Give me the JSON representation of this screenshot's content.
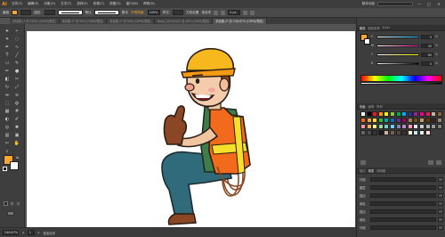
{
  "menubar": {
    "logo": "Ai",
    "items": [
      "文件(F)",
      "编辑(E)",
      "对象(O)",
      "文字(T)",
      "选择(S)",
      "效果(C)",
      "视图(V)",
      "窗口(W)",
      "帮助(H)"
    ],
    "workspace": "基本功能",
    "window_buttons": [
      "—",
      "□",
      "✕"
    ]
  },
  "controlbar": {
    "selection_label": "编组",
    "stroke_label": "描边:",
    "uniform_label": "等比",
    "brush_label": "基本",
    "opacity_label": "不透明度:",
    "opacity_value": "100%",
    "style_label": "样式:",
    "doc_setup_label": "文档设置",
    "prefs_label": "首选项",
    "x_value": "0 px",
    "fill_color": "#f7a633"
  },
  "tabs": [
    {
      "label": "无标题-1* @ 300% (CMYK/预览)",
      "active": false
    },
    {
      "label": "未标题-1* @ 50% (CMYK/预览)",
      "active": false
    },
    {
      "label": "未标题-1* @ 50% (CMYK/预览)",
      "active": false
    },
    {
      "label": "Nope_20151022 @ 25% (CMYK/预览)",
      "active": false
    },
    {
      "label": "未标题-1* @ 246.67% (CMYK/预览)",
      "active": true
    }
  ],
  "tools": [
    "selection-arrow-icon",
    "direct-selection-icon",
    "magic-wand-icon",
    "lasso-icon",
    "pen-icon",
    "curvature-icon",
    "type-icon",
    "line-icon",
    "rectangle-icon",
    "paintbrush-icon",
    "pencil-icon",
    "blob-brush-icon",
    "eraser-icon",
    "scissors-icon",
    "rotate-icon",
    "scale-icon",
    "width-icon",
    "warp-icon",
    "free-transform-icon",
    "shape-builder-icon",
    "perspective-icon",
    "mesh-icon",
    "gradient-icon",
    "eyedropper-icon",
    "blend-icon",
    "symbol-sprayer-icon",
    "column-graph-icon",
    "artboard-icon",
    "slice-icon",
    "hand-icon",
    "zoom-icon"
  ],
  "toolbar": {
    "fill_color": "#f7a633",
    "stroke_color": "#ffffff",
    "mode_icons": [
      "normal-draw-icon",
      "draw-behind-icon",
      "draw-inside-icon"
    ],
    "screen_mode_icon": "screen-mode-icon"
  },
  "status": {
    "zoom": "246.67%",
    "artboard": "1",
    "tool_name": "直接选择"
  },
  "color_panel": {
    "tabs": [
      "颜色",
      "颜色参考",
      "Kuler"
    ],
    "active_tab": "颜色",
    "sliders": [
      {
        "label": "C",
        "value": "0",
        "gradient": "#ffffff,#00aeef"
      },
      {
        "label": "M",
        "value": "45",
        "gradient": "#ffffff,#ec008c"
      },
      {
        "label": "Y",
        "value": "85",
        "gradient": "#ffffff,#fff200"
      },
      {
        "label": "K",
        "value": "0",
        "gradient": "#ffffff,#000000"
      }
    ],
    "fill_color": "#f7a633",
    "stroke_color": "#ffffff"
  },
  "swatches_panel": {
    "tabs": [
      "色板",
      "画笔",
      "符号"
    ],
    "active_tab": "色板",
    "colors": [
      "#ffffff",
      "#000000",
      "#ec1c24",
      "#f7941d",
      "#fff200",
      "#8dc63f",
      "#00a651",
      "#00aeef",
      "#2e3192",
      "#92278f",
      "#ec008c",
      "#ed145b",
      "#c2b59b",
      "#8c6239",
      "#f26522",
      "#f7a633",
      "#ffde17",
      "#39b54a",
      "#00a99d",
      "#0072bc",
      "#662d91",
      "#9e005d",
      "#a67c52",
      "#754c24",
      "#c69c6d",
      "#603913",
      "#3c2415",
      "#998675",
      "#f5989d",
      "#fbaf5d",
      "#fff799",
      "#a3d39c",
      "#7accc8",
      "#6dcff6",
      "#8781bd",
      "#bd8cbf",
      "#f49ac1",
      "#e6e6e6",
      "#cccccc",
      "#b3b3b3",
      "#999999",
      "#808080",
      "#666666",
      "#4d4d4d",
      "#333333",
      "#1a1a1a",
      "#c7b299",
      "#736357",
      "#534741",
      "#362f2d",
      "#fff5d7",
      "#c1e5f5",
      "#e3f4de",
      "#fde0e2"
    ]
  },
  "properties_panel": {
    "tabs": [
      "描边",
      "渐变",
      "透明度"
    ],
    "active_tab": "渐变",
    "rows": [
      {
        "name": "外观"
      },
      {
        "name": "图层"
      },
      {
        "name": "描边"
      },
      {
        "name": "填色"
      },
      {
        "name": "描边"
      },
      {
        "name": "填色"
      },
      {
        "name": "外观"
      }
    ]
  }
}
